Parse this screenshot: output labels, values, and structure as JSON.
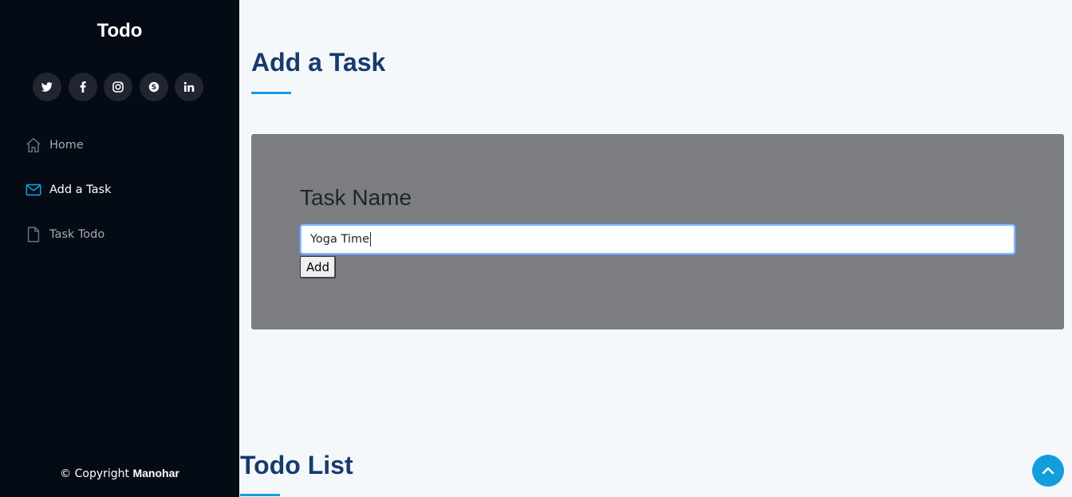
{
  "sidebar": {
    "brand": "Todo",
    "social": [
      {
        "name": "twitter-icon"
      },
      {
        "name": "facebook-icon"
      },
      {
        "name": "instagram-icon"
      },
      {
        "name": "skype-icon"
      },
      {
        "name": "linkedin-icon"
      }
    ],
    "nav": [
      {
        "label": "Home",
        "icon": "house-icon",
        "active": false
      },
      {
        "label": "Add a Task",
        "icon": "envelope-icon",
        "active": true
      },
      {
        "label": "Task Todo",
        "icon": "file-icon",
        "active": false
      }
    ],
    "copyright_prefix": "© Copyright",
    "copyright_name": "Manohar"
  },
  "main": {
    "add_section_title": "Add a Task",
    "form": {
      "label": "Task Name",
      "input_value": "Yoga Time",
      "button_label": "Add"
    },
    "list_section_title": "Todo List"
  },
  "colors": {
    "sidebar_bg": "#040b14",
    "accent": "#149ddd",
    "heading": "#173b6c",
    "card_bg": "#7c7d80"
  },
  "icons": {
    "scroll_top": "chevron-up-icon"
  }
}
